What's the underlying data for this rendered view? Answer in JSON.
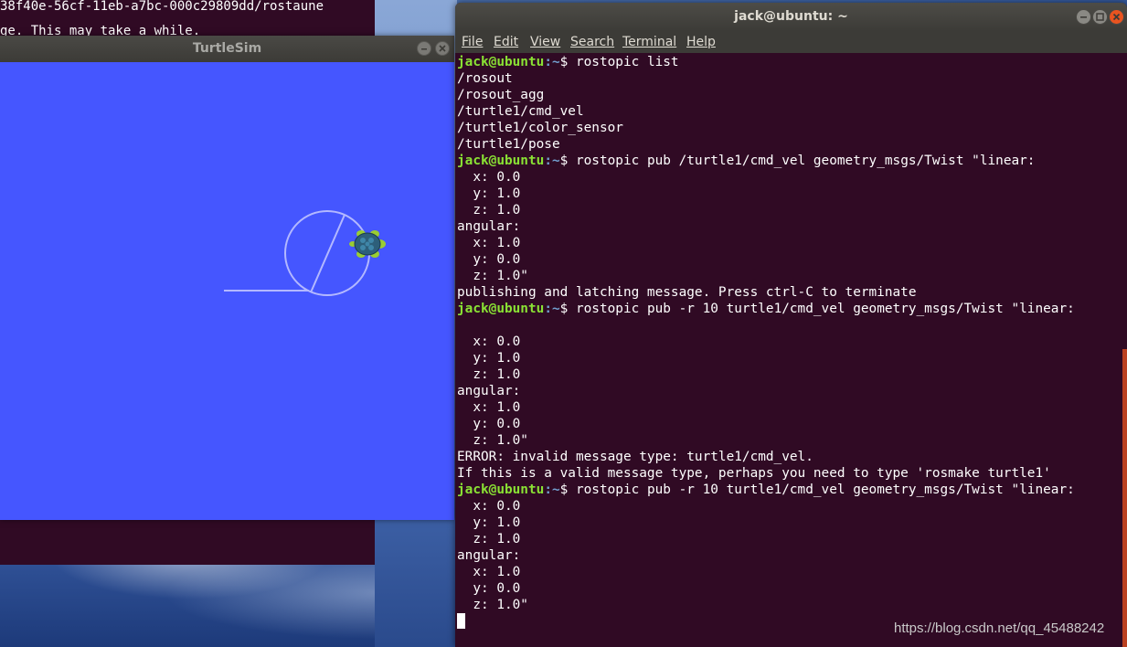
{
  "back_terminal": {
    "line1": "38f40e-56cf-11eb-a7bc-000c29809dd/rostaune",
    "line2": "ge. This may take a while."
  },
  "turtlesim": {
    "title": "TurtleSim",
    "background_color": "#4556ff"
  },
  "terminal": {
    "title": "jack@ubuntu: ~",
    "menu": [
      "File",
      "Edit",
      "View",
      "Search",
      "Terminal",
      "Help"
    ],
    "prompt_user": "jack@ubuntu",
    "prompt_path": ":~",
    "lines": [
      {
        "type": "prompt",
        "text": "$ rostopic list"
      },
      {
        "type": "out",
        "text": "/rosout"
      },
      {
        "type": "out",
        "text": "/rosout_agg"
      },
      {
        "type": "out",
        "text": "/turtle1/cmd_vel"
      },
      {
        "type": "out",
        "text": "/turtle1/color_sensor"
      },
      {
        "type": "out",
        "text": "/turtle1/pose"
      },
      {
        "type": "prompt",
        "text": "$ rostopic pub /turtle1/cmd_vel geometry_msgs/Twist \"linear:"
      },
      {
        "type": "out",
        "text": "  x: 0.0"
      },
      {
        "type": "out",
        "text": "  y: 1.0"
      },
      {
        "type": "out",
        "text": "  z: 1.0"
      },
      {
        "type": "out",
        "text": "angular:"
      },
      {
        "type": "out",
        "text": "  x: 1.0"
      },
      {
        "type": "out",
        "text": "  y: 0.0"
      },
      {
        "type": "out",
        "text": "  z: 1.0\""
      },
      {
        "type": "out",
        "text": "publishing and latching message. Press ctrl-C to terminate"
      },
      {
        "type": "prompt",
        "text": "$ rostopic pub -r 10 turtle1/cmd_vel geometry_msgs/Twist \"linear:"
      },
      {
        "type": "out",
        "text": ""
      },
      {
        "type": "out",
        "text": "  x: 0.0"
      },
      {
        "type": "out",
        "text": "  y: 1.0"
      },
      {
        "type": "out",
        "text": "  z: 1.0"
      },
      {
        "type": "out",
        "text": "angular:"
      },
      {
        "type": "out",
        "text": "  x: 1.0"
      },
      {
        "type": "out",
        "text": "  y: 0.0"
      },
      {
        "type": "out",
        "text": "  z: 1.0\""
      },
      {
        "type": "out",
        "text": "ERROR: invalid message type: turtle1/cmd_vel."
      },
      {
        "type": "out",
        "text": "If this is a valid message type, perhaps you need to type 'rosmake turtle1'"
      },
      {
        "type": "prompt",
        "text": "$ rostopic pub -r 10 turtle1/cmd_vel geometry_msgs/Twist \"linear:"
      },
      {
        "type": "out",
        "text": "  x: 0.0"
      },
      {
        "type": "out",
        "text": "  y: 1.0"
      },
      {
        "type": "out",
        "text": "  z: 1.0"
      },
      {
        "type": "out",
        "text": "angular:"
      },
      {
        "type": "out",
        "text": "  x: 1.0"
      },
      {
        "type": "out",
        "text": "  y: 0.0"
      },
      {
        "type": "out",
        "text": "  z: 1.0\""
      },
      {
        "type": "cursor",
        "text": ""
      }
    ]
  },
  "watermark": "https://blog.csdn.net/qq_45488242",
  "colors": {
    "terminal_bg": "#300a24",
    "prompt_user": "#8ae234",
    "prompt_path": "#729fcf",
    "accent": "#e95420"
  }
}
